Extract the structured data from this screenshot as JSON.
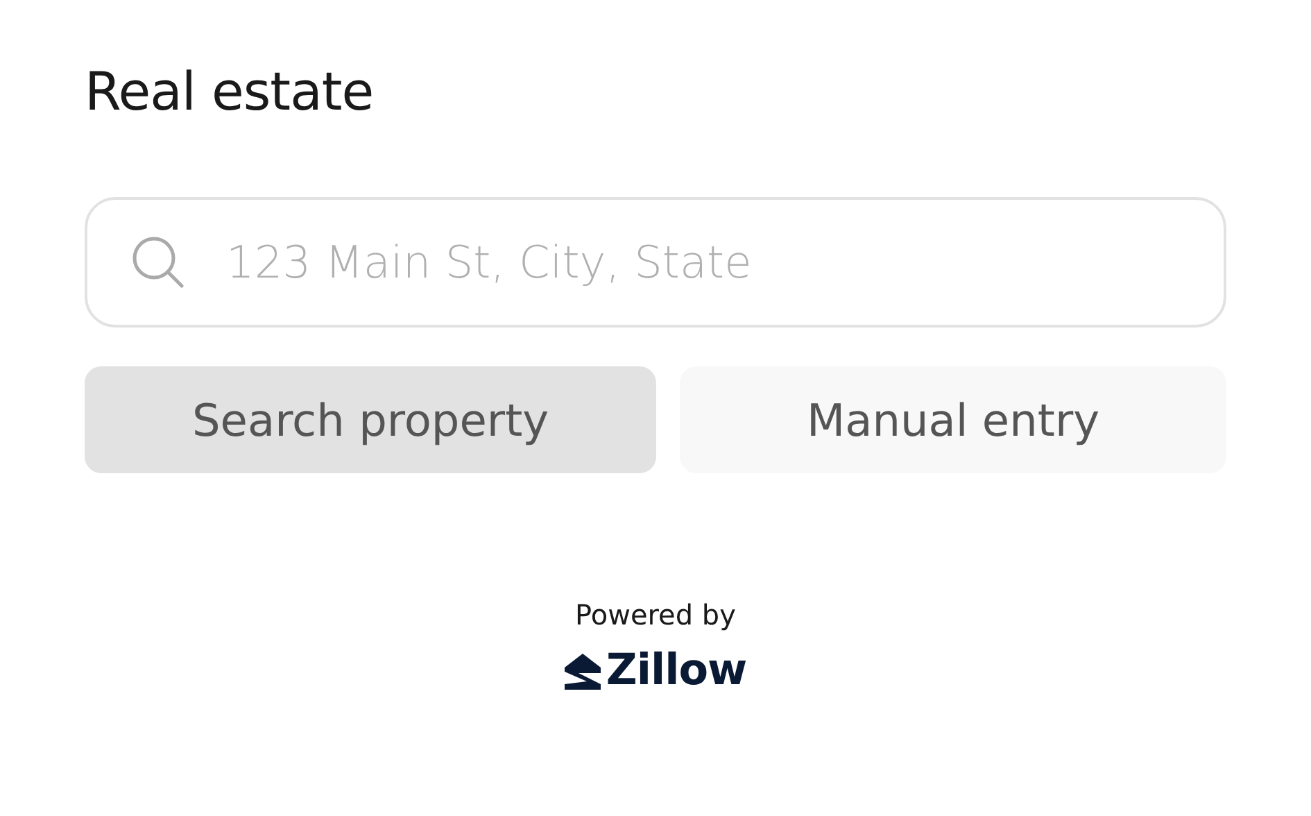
{
  "title": "Real estate",
  "search": {
    "placeholder": "123 Main St, City, State"
  },
  "buttons": [
    {
      "label": "Search property",
      "selected": true
    },
    {
      "label": "Manual entry",
      "selected": false
    }
  ],
  "footer": {
    "powered_by": "Powered by",
    "brand": "Zillow"
  }
}
